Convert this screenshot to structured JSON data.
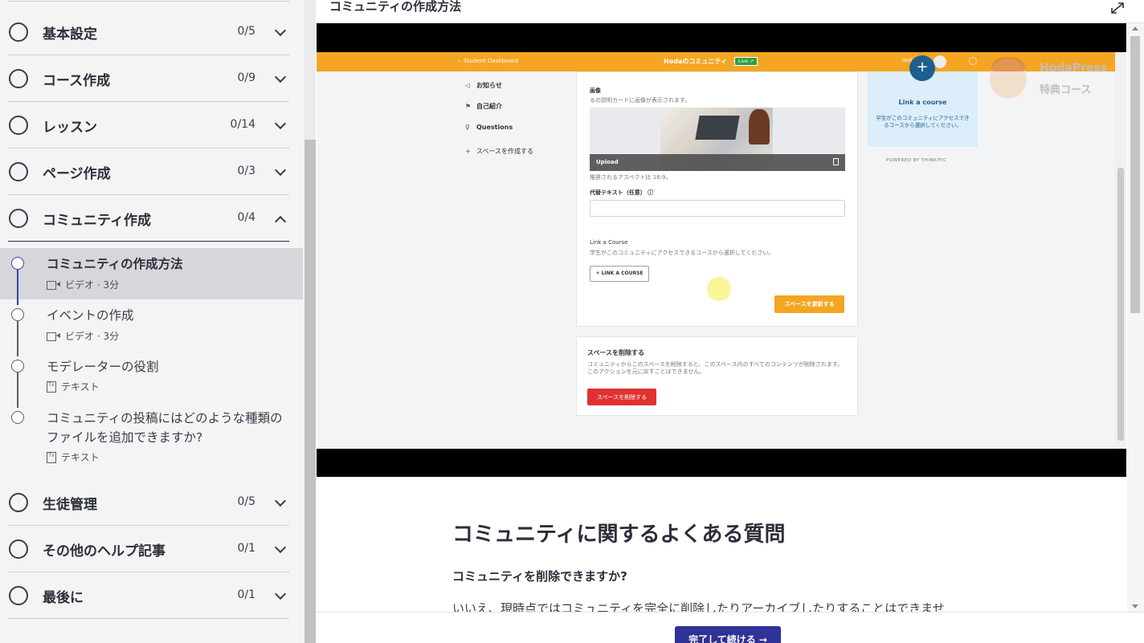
{
  "sidebar": {
    "sections": [
      {
        "title": "基本設定",
        "count": "0/5"
      },
      {
        "title": "コース作成",
        "count": "0/9"
      },
      {
        "title": "レッスン",
        "count": "0/14"
      },
      {
        "title": "ページ作成",
        "count": "0/3"
      },
      {
        "title": "コミュニティ作成",
        "count": "0/4"
      },
      {
        "title": "生徒管理",
        "count": "0/5"
      },
      {
        "title": "その他のヘルプ記事",
        "count": "0/1"
      },
      {
        "title": "最後に",
        "count": "0/1"
      }
    ],
    "lessons": [
      {
        "title": "コミュニティの作成方法",
        "meta": "ビデオ · 3分"
      },
      {
        "title": "イベントの作成",
        "meta": "ビデオ · 3分"
      },
      {
        "title": "モデレーターの役割",
        "meta": "テキスト"
      },
      {
        "title": "コミュニティの投稿にはどのような種類のファイルを追加できますか?",
        "meta": "テキスト"
      }
    ]
  },
  "main": {
    "lesson_title": "コミュニティの作成方法",
    "complete_button": "完了して続ける →"
  },
  "video": {
    "back_link": "Student Dashboard",
    "community_title": "Hodaのコミュニティ",
    "live_badge": "Live ↗",
    "user_name": "Hoda Press",
    "nav": [
      "お知らせ",
      "自己紹介",
      "Questions",
      "スペースを作成する"
    ],
    "image_label": "画像",
    "image_hint": "るの説明カードに画像が表示されます。",
    "upload_label": "Upload",
    "aspect_hint": "推奨されるアスペクト比 16:9。",
    "alt_label": "代替テキスト（任意）",
    "link_label": "Link a Course",
    "link_hint": "学生がこのコミュニティにアクセスできるコースから選択してください。",
    "link_button": "+ LINK A COURSE",
    "update_button": "スペースを更新する",
    "delete_title": "スペースを削除する",
    "delete_hint": "コミュニティからこのスペースを削除すると、このスペース内のすべてのコンテンツが削除されます。このアクションを元に戻すことはできません。",
    "delete_button": "スペースを削除する",
    "side_card_title": "Link a course",
    "side_card_desc": "学生がこのコミュニティにアクセスできるコースから選択してください。",
    "powered_by": "POWERED BY THINKIFIC",
    "watermark_1": "HodaPress",
    "watermark_2": "特典コース"
  },
  "faq": {
    "heading": "コミュニティに関するよくある質問",
    "question": "コミュニティを削除できますか?",
    "answer": "いいえ、現時点ではコミュニティを完全に削除したりアーカイブしたりすることはできませ"
  }
}
